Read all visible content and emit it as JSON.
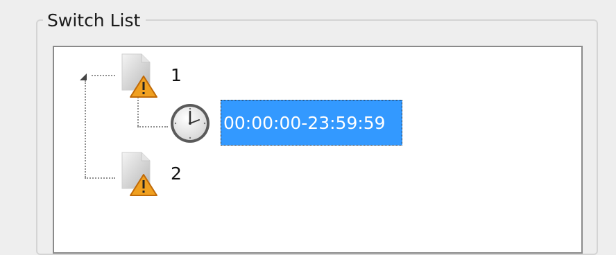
{
  "group": {
    "title": "Switch List"
  },
  "tree": {
    "nodes": [
      {
        "label": "1",
        "icon": "document-warning-icon",
        "expanded": true,
        "children": [
          {
            "label": "00:00:00-23:59:59",
            "icon": "clock-icon",
            "selected": true
          }
        ]
      },
      {
        "label": "2",
        "icon": "document-warning-icon",
        "expanded": false
      }
    ]
  },
  "colors": {
    "selection": "#3399ff",
    "warning": "#f0a020",
    "panel_border": "#8a8a8a"
  }
}
